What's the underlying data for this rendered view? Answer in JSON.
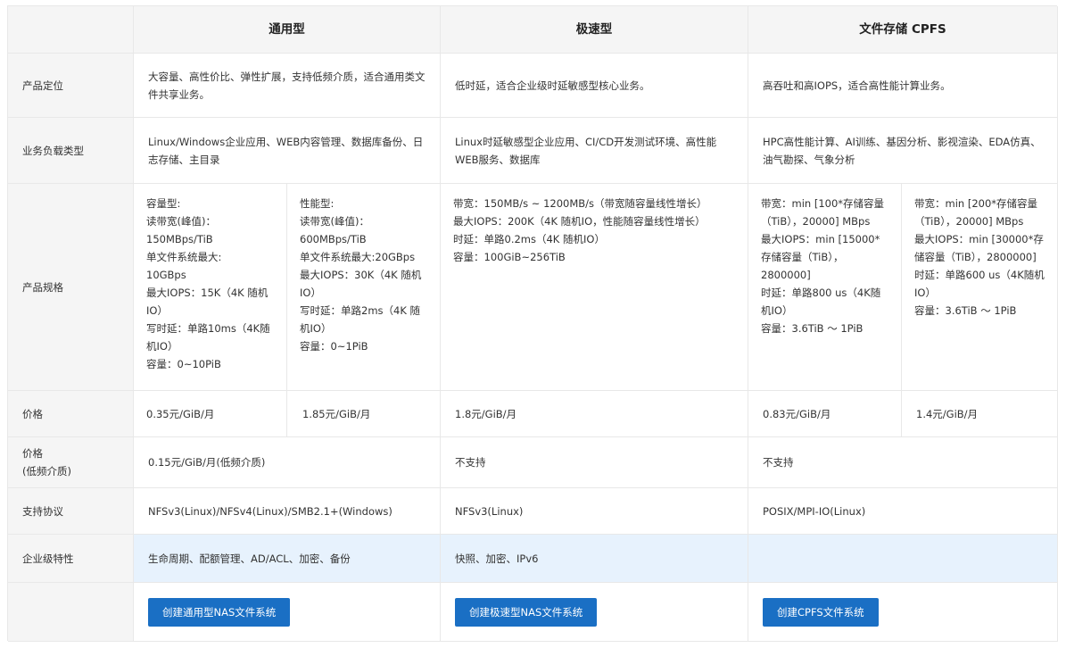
{
  "columns": [
    "通用型",
    "极速型",
    "文件存储 CPFS"
  ],
  "rows": {
    "positioning": {
      "label": "产品定位",
      "general": "大容量、高性价比、弹性扩展，支持低频介质，适合通用类文件共享业务。",
      "extreme": "低时延，适合企业级时延敏感型核心业务。",
      "cpfs": "高吞吐和高IOPS，适合高性能计算业务。"
    },
    "workload": {
      "label": "业务负载类型",
      "general": "Linux/Windows企业应用、WEB内容管理、数据库备份、日志存储、主目录",
      "extreme": "Linux时延敏感型企业应用、CI/CD开发测试环境、高性能WEB服务、数据库",
      "cpfs": "HPC高性能计算、AI训练、基因分析、影视渲染、EDA仿真、油气勘探、气象分析"
    },
    "spec": {
      "label": "产品规格",
      "general_capacity": "容量型:\n读带宽(峰值)：\n150MBps/TiB\n单文件系统最大:\n10GBps\n最大IOPS：15K（4K 随机IO）\n写时延：单路10ms（4K随机IO）\n容量：0~10PiB",
      "general_performance": "性能型:\n读带宽(峰值)：\n600MBps/TiB\n单文件系统最大:20GBps\n最大IOPS：30K（4K 随机IO）\n写时延：单路2ms（4K 随机IO）\n容量：0~1PiB",
      "extreme": "带宽：150MB/s ~ 1200MB/s（带宽随容量线性增长）\n最大IOPS：200K（4K 随机IO，性能随容量线性增长）\n时延：单路0.2ms（4K 随机IO）\n容量：100GiB~256TiB",
      "cpfs_a": "带宽：min [100*存储容量（TiB），20000] MBps\n最大IOPS：min [15000*存储容量（TiB），2800000]\n时延：单路800 us（4K随机IO）\n容量：3.6TiB ～ 1PiB",
      "cpfs_b": "带宽：min [200*存储容量（TiB），20000] MBps\n最大IOPS：min [30000*存储容量（TiB），2800000]\n时延：单路600 us（4K随机IO）\n容量：3.6TiB ～ 1PiB"
    },
    "price": {
      "label": "价格",
      "general_capacity": "0.35元/GiB/月",
      "general_performance": "1.85元/GiB/月",
      "extreme": "1.8元/GiB/月",
      "cpfs_a": "0.83元/GiB/月",
      "cpfs_b": "1.4元/GiB/月"
    },
    "price_low": {
      "label_line1": "价格",
      "label_line2": "(低频介质)",
      "general": "0.15元/GiB/月(低频介质)",
      "extreme": "不支持",
      "cpfs": "不支持"
    },
    "protocol": {
      "label": "支持协议",
      "general": "NFSv3(Linux)/NFSv4(Linux)/SMB2.1+(Windows)",
      "extreme": "NFSv3(Linux)",
      "cpfs": "POSIX/MPI-IO(Linux)"
    },
    "enterprise": {
      "label": "企业级特性",
      "general": "生命周期、配额管理、AD/ACL、加密、备份",
      "extreme": "快照、加密、IPv6",
      "cpfs": ""
    }
  },
  "buttons": {
    "general": "创建通用型NAS文件系统",
    "extreme": "创建极速型NAS文件系统",
    "cpfs": "创建CPFS文件系统"
  },
  "colors": {
    "header_bg": "#f5f5f5",
    "highlight_bg": "#e7f2fd",
    "button_bg": "#1a6fc4",
    "border": "#e8e8e8"
  }
}
